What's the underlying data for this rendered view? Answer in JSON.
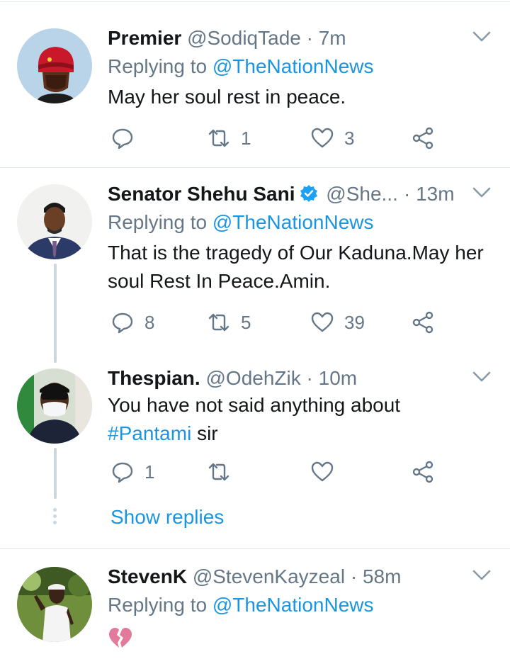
{
  "colors": {
    "accent": "#1b95e0",
    "muted": "#657786",
    "text": "#14171a",
    "divider": "#e1e8ed",
    "thread": "#ccd6dd"
  },
  "tweets": [
    {
      "name": "Premier",
      "handle": "@SodiqTade",
      "sep": "·",
      "time": "7m",
      "reply_prefix": "Replying to",
      "reply_to": "@TheNationNews",
      "text": "May her soul rest in peace.",
      "replies": "",
      "retweets": "1",
      "likes": "3"
    },
    {
      "name": "Senator Shehu Sani",
      "handle": "@She...",
      "sep": "·",
      "time": "13m",
      "reply_prefix": "Replying to",
      "reply_to": "@TheNationNews",
      "text": "That is the tragedy of Our Kaduna.May her soul Rest In Peace.Amin.",
      "replies": "8",
      "retweets": "5",
      "likes": "39"
    },
    {
      "name": "Thespian.",
      "handle": "@OdehZik",
      "sep": "·",
      "time": "10m",
      "text_before": "You have not said anything about",
      "hashtag": "#Pantami",
      "text_after": " sir",
      "replies": "1",
      "retweets": "",
      "likes": ""
    },
    {
      "name": "StevenK",
      "handle": "@StevenKayzeal",
      "sep": "·",
      "time": "58m",
      "reply_prefix": "Replying to",
      "reply_to": "@TheNationNews",
      "emoji": "broken-heart-emoji"
    }
  ],
  "show_replies": "Show replies",
  "icons": {
    "reply": "reply-icon",
    "retweet": "retweet-icon",
    "like": "heart-icon",
    "share": "share-icon",
    "caret": "chevron-down-icon",
    "verified": "verified-badge-icon"
  }
}
